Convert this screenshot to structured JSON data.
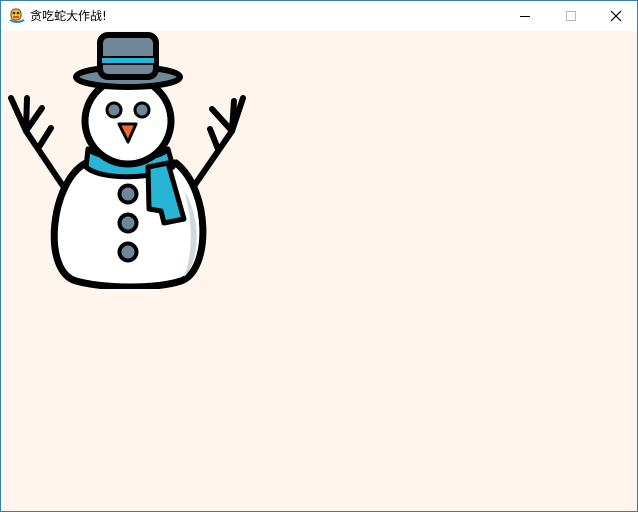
{
  "window": {
    "title": "贪吃蛇大作战!",
    "app_icon": "python-snake-icon",
    "controls": {
      "minimize_icon": "minimize-icon",
      "maximize_icon": "maximize-icon",
      "close_icon": "close-icon"
    }
  },
  "canvas": {
    "background_color": "#fff5ef",
    "sprite": "snowman-icon"
  },
  "colors": {
    "hat": "#6e8899",
    "scarf": "#27b5d6",
    "nose": "#f26a2a",
    "body": "#ffffff",
    "outline": "#000000"
  }
}
